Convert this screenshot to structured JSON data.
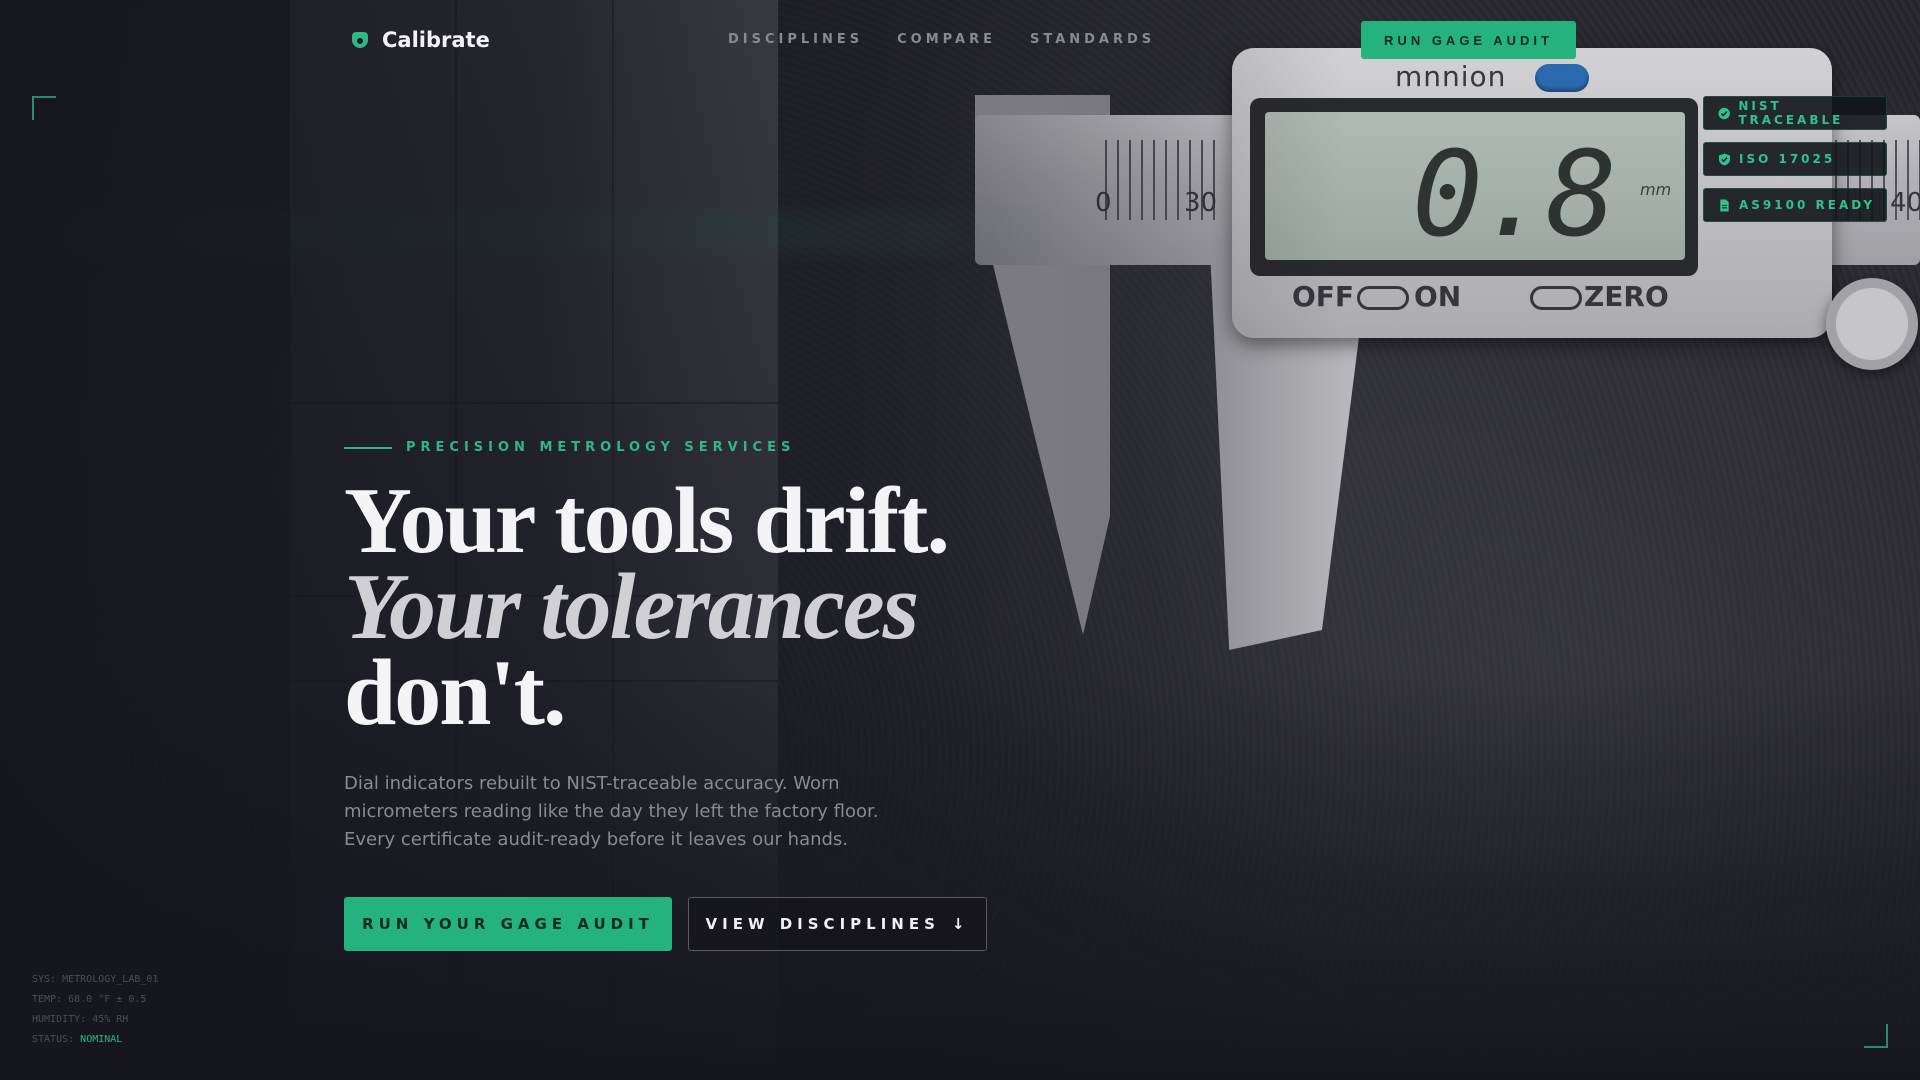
{
  "nav": {
    "brand": "Calibrate",
    "links": [
      "DISCIPLINES",
      "COMPARE",
      "STANDARDS"
    ],
    "cta_label": "RUN GAGE AUDIT"
  },
  "badges": [
    {
      "label": "NIST TRACEABLE",
      "icon": "check-circle-icon"
    },
    {
      "label": "ISO 17025",
      "icon": "shield-check-icon"
    },
    {
      "label": "AS9100 READY",
      "icon": "document-icon"
    }
  ],
  "hero": {
    "eyebrow": "PRECISION METROLOGY SERVICES",
    "headline_line1": "Your tools drift.",
    "headline_line2": "Your tolerances",
    "headline_line3": "don't.",
    "subtext": "Dial indicators rebuilt to NIST-traceable accuracy. Worn micrometers reading like the day they left the factory floor. Every certificate audit-ready before it leaves our hands.",
    "primary_cta": "RUN YOUR GAGE AUDIT",
    "secondary_cta": "VIEW DISCIPLINES",
    "secondary_icon": "↓"
  },
  "photo": {
    "brand": "mnnion",
    "lcd_value": "0.8",
    "lcd_unit": "mm",
    "labels": {
      "off": "OFF",
      "on": "ON",
      "zero": "ZERO"
    },
    "scale_numbers": [
      "0",
      "30",
      "40"
    ]
  },
  "status": {
    "sys": "SYS: METROLOGY_LAB_01",
    "temp": "TEMP: 68.0 °F ± 0.5",
    "humidity": "HUMIDITY: 45% RH",
    "status_label": "STATUS: ",
    "status_value": "NOMINAL"
  },
  "colors": {
    "accent": "#24b37e",
    "background": "#17171f"
  }
}
